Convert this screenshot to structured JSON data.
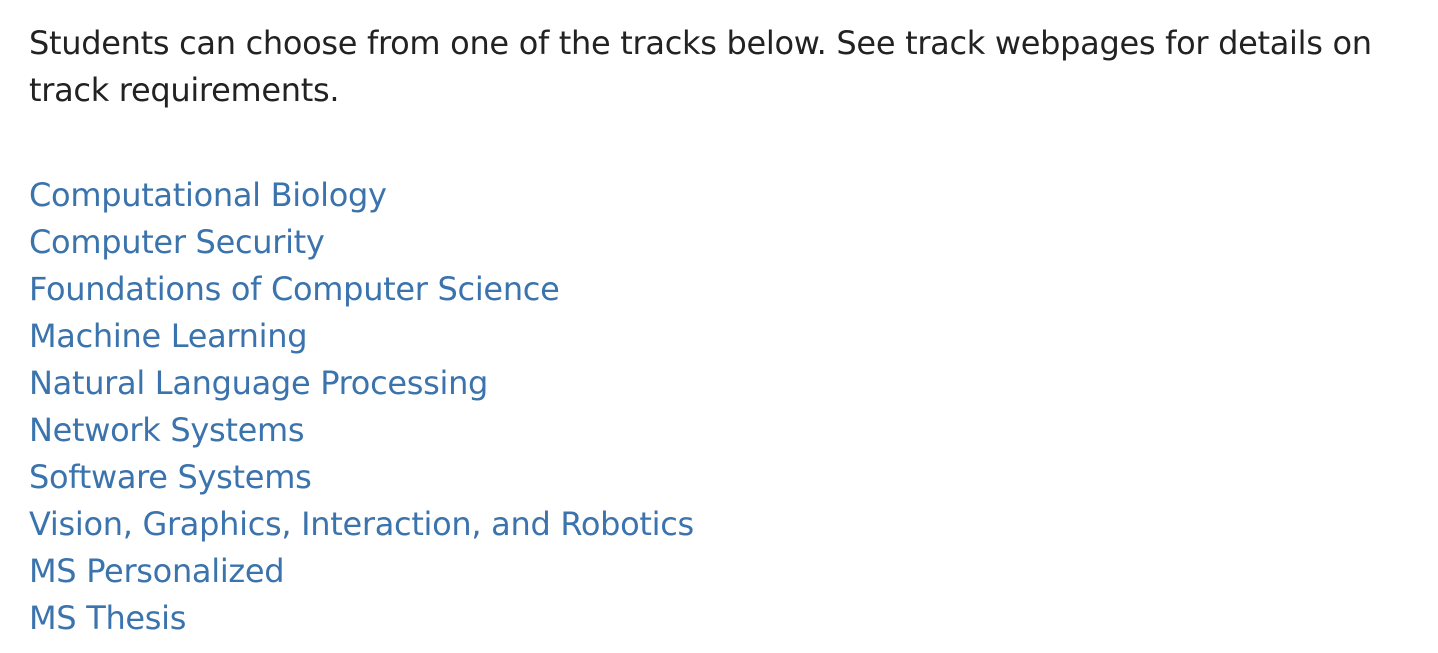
{
  "intro": {
    "text": "Students can choose from one of the tracks below. See track webpages for details on track requirements."
  },
  "tracks": [
    {
      "label": "Computational Biology"
    },
    {
      "label": "Computer Security"
    },
    {
      "label": "Foundations of Computer Science"
    },
    {
      "label": "Machine Learning"
    },
    {
      "label": "Natural Language Processing"
    },
    {
      "label": "Network Systems"
    },
    {
      "label": "Software Systems"
    },
    {
      "label": "Vision, Graphics, Interaction, and Robotics"
    },
    {
      "label": "MS Personalized"
    },
    {
      "label": "MS Thesis"
    }
  ],
  "colors": {
    "text": "#222222",
    "link": "#3b73ad",
    "background": "#ffffff"
  }
}
